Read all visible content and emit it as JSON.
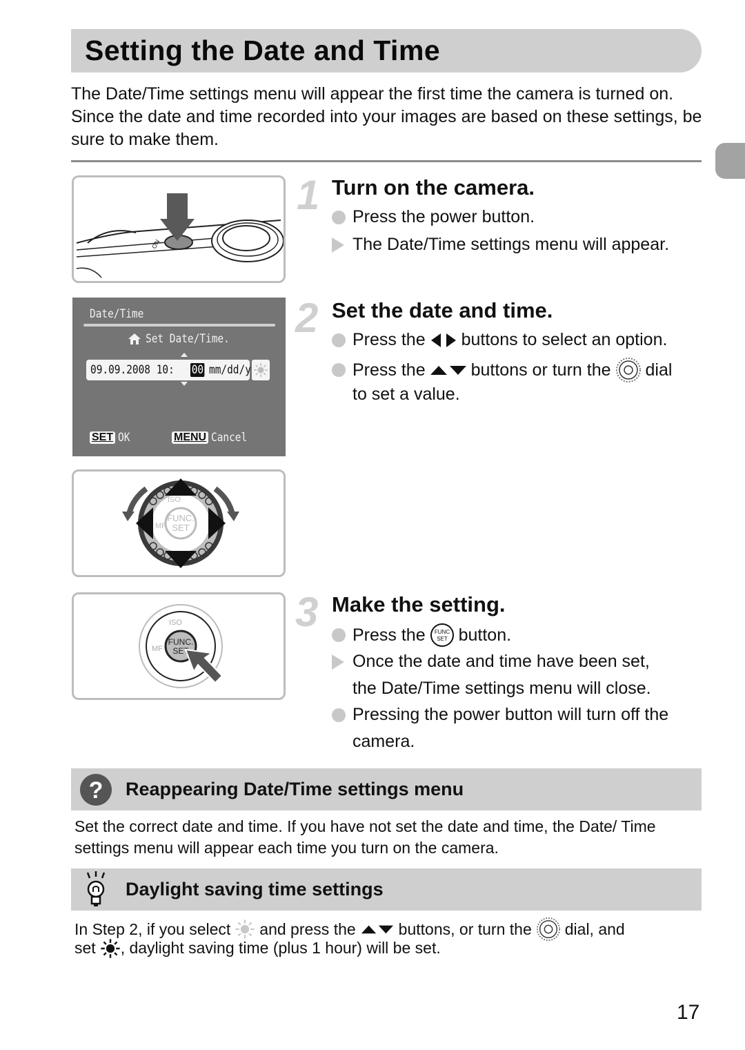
{
  "page": {
    "title": "Setting the Date and Time",
    "intro": "The Date/Time settings menu will appear the first time the camera is turned on. Since the date and time recorded into your images are based on these settings, be sure to make them.",
    "page_number": "17"
  },
  "screen": {
    "header": "Date/Time",
    "message": "Set Date/Time.",
    "date_prefix": "09.09.2008 10:",
    "selected_value": "00",
    "format": "mm/dd/yy",
    "ok_key": "SET",
    "ok_label": "OK",
    "cancel_key": "MENU",
    "cancel_label": "Cancel"
  },
  "dial": {
    "center_top": "FUNC.",
    "center_bottom": "SET",
    "label_iso": "ISO",
    "label_mf": "MF"
  },
  "steps": [
    {
      "number": "1",
      "title": "Turn on the camera.",
      "items": [
        {
          "type": "action",
          "text": "Press the power button."
        },
        {
          "type": "result",
          "text": "The Date/Time settings menu will appear."
        }
      ]
    },
    {
      "number": "2",
      "title": "Set the date and time.",
      "items": [
        {
          "type": "action",
          "pre": "Press the",
          "icon": "left-right-buttons",
          "post": "buttons to select an option."
        },
        {
          "type": "action",
          "pre": "Press the",
          "icon": "up-down-buttons",
          "mid": "buttons or turn the",
          "icon2": "control-dial",
          "post": "dial",
          "cont": "to set a value."
        }
      ]
    },
    {
      "number": "3",
      "title": "Make the setting.",
      "items": [
        {
          "type": "action",
          "pre": "Press the",
          "icon": "func-set-button",
          "post": "button."
        },
        {
          "type": "result",
          "text": "Once the date and time have been set,",
          "cont": "the Date/Time settings menu will close."
        },
        {
          "type": "action",
          "text": "Pressing the power button will turn off the",
          "cont": "camera."
        }
      ]
    }
  ],
  "notes": [
    {
      "icon": "question-icon",
      "title": "Reappearing Date/Time settings menu",
      "body": "Set the correct date and time. If you have not set the date and time, the Date/ Time settings menu will appear each time you turn on the camera."
    },
    {
      "icon": "lightbulb-icon",
      "title": "Daylight saving time settings",
      "line1_a": "In Step 2, if you select",
      "line1_b": "and press the",
      "line1_c": "buttons, or turn the",
      "line1_d": "dial, and",
      "line2_a": "set",
      "line2_b": ", daylight saving time (plus 1 hour) will be set."
    }
  ],
  "colors": {
    "band_gray": "#cfcfcf",
    "screen_gray": "#757575",
    "bullet_gray": "#c8c8c8",
    "tab_gray": "#a3a3a3"
  }
}
